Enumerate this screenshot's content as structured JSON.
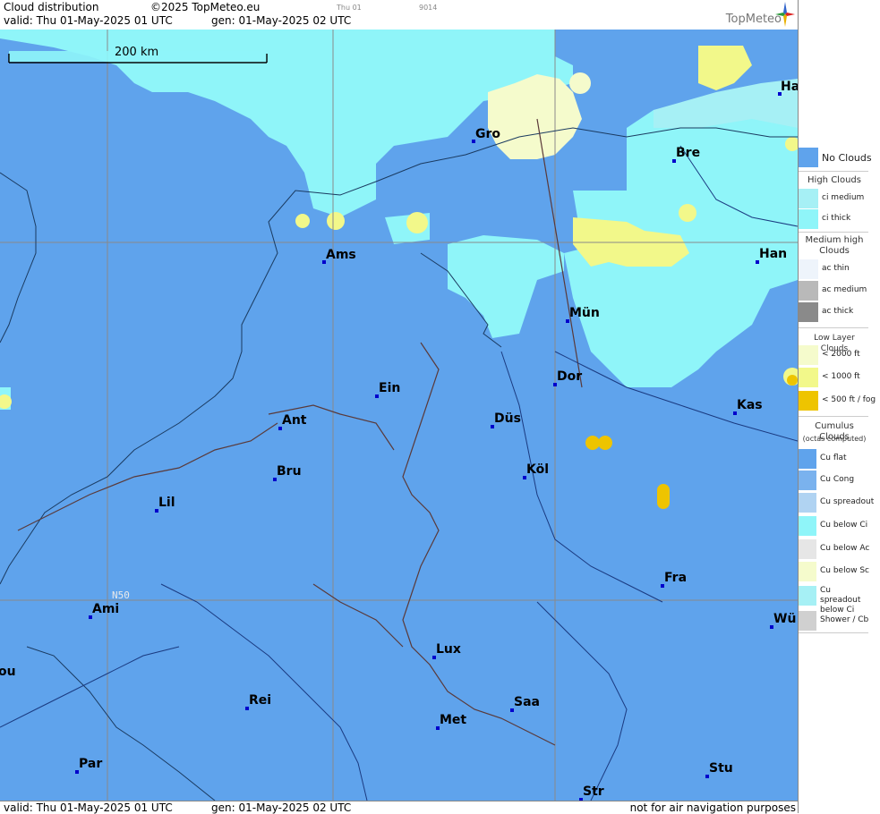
{
  "header": {
    "title": "Cloud distribution",
    "copyright": "©2025 TopMeteo.eu",
    "valid": "valid:  Thu  01-May-2025  01 UTC",
    "generated": "gen: 01-May-2025 02 UTC",
    "small_day": "Thu 01",
    "small_code": "9014",
    "logo": "TopMeteo"
  },
  "footer": {
    "valid": "valid:  Thu  01-May-2025  01 UTC",
    "generated": "gen: 01-May-2025 02 UTC",
    "disclaimer": "not for air navigation purposes"
  },
  "map": {
    "scale_label": "200 km",
    "lat_label": "N50",
    "cities": [
      {
        "name": "Ha"
      },
      {
        "name": "Gro"
      },
      {
        "name": "Bre"
      },
      {
        "name": "Ams"
      },
      {
        "name": "Han"
      },
      {
        "name": "Mün"
      },
      {
        "name": "Ein"
      },
      {
        "name": "Dor"
      },
      {
        "name": "Kas"
      },
      {
        "name": "Ant"
      },
      {
        "name": "Düs"
      },
      {
        "name": "Bru"
      },
      {
        "name": "Köl"
      },
      {
        "name": "Lil"
      },
      {
        "name": "Fra"
      },
      {
        "name": "Ami"
      },
      {
        "name": "Wü"
      },
      {
        "name": "Lux"
      },
      {
        "name": "Rei"
      },
      {
        "name": "ou"
      },
      {
        "name": "Saa"
      },
      {
        "name": "Met"
      },
      {
        "name": "Par"
      },
      {
        "name": "Stu"
      },
      {
        "name": "Str"
      }
    ]
  },
  "legend": {
    "no_clouds": "No Clouds",
    "high_title": "High Clouds",
    "ci_medium": "ci medium",
    "ci_thick": "ci thick",
    "medium_title": "Medium high Clouds",
    "ac_thin": "ac thin",
    "ac_medium": "ac medium",
    "ac_thick": "ac thick",
    "low_title": "Low Layer Clouds",
    "low_2000": "< 2000 ft",
    "low_1000": "< 1000 ft",
    "low_500": "< 500 ft / fog",
    "cu_title": "Cumulus Clouds",
    "cu_sub": "(octas computed)",
    "cu_flat": "Cu flat",
    "cu_cong": "Cu Cong",
    "cu_spread": "Cu spreadout",
    "cu_below_ci": "Cu below Ci",
    "cu_below_ac": "Cu below Ac",
    "cu_below_sc": "Cu below Sc",
    "cu_spread_ci": "Cu spreadout below Ci",
    "shower": "Shower / Cb"
  },
  "colors": {
    "no_clouds": "#5fa3ec",
    "ci_medium": "#a6f0f5",
    "ci_thick": "#8ff5f9",
    "low_2000": "#f5fbcc",
    "low_1000": "#f2f88a",
    "low_500": "#eec400"
  }
}
